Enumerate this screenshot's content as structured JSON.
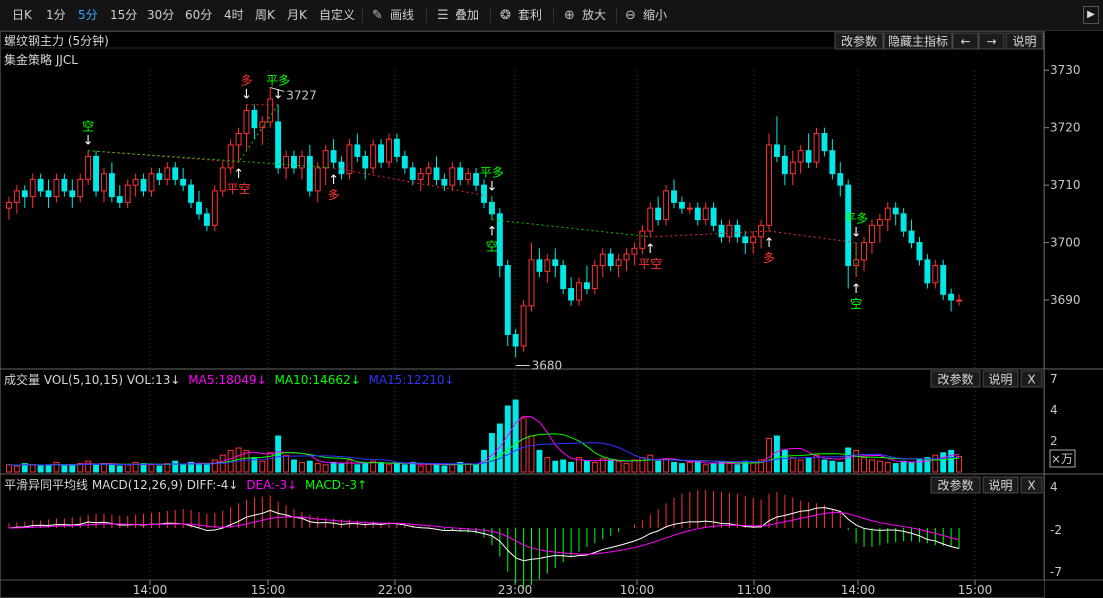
{
  "toolbar": {
    "periods": [
      "日K",
      "1分",
      "5分",
      "15分",
      "30分",
      "60分",
      "4时",
      "周K",
      "月K",
      "自定义"
    ],
    "active_period": "5分",
    "tools": [
      {
        "icon": "pencil-icon",
        "label": "画线"
      },
      {
        "icon": "layers-icon",
        "label": "叠加"
      },
      {
        "icon": "money-bag-icon",
        "label": "套利"
      },
      {
        "icon": "zoom-in-icon",
        "label": "放大"
      },
      {
        "icon": "zoom-out-icon",
        "label": "缩小"
      }
    ],
    "next_glyph": "▶"
  },
  "main_panel": {
    "title": "螺纹钢主力 (5分钟)",
    "strategy": "集金策略 JJCL",
    "buttons": [
      "改参数",
      "隐藏主指标",
      "←",
      "→",
      "说明"
    ]
  },
  "volume_panel": {
    "label_prefix": "成交量 VOL(5,10,15) VOL:13↓",
    "ma5": "MA5:18049↓",
    "ma10": "MA10:14662↓",
    "ma15": "MA15:12210↓",
    "buttons": [
      "改参数",
      "说明",
      "X"
    ],
    "unit_label": "×万",
    "ticks": [
      "7",
      "4",
      "2"
    ]
  },
  "macd_panel": {
    "label_prefix": "平滑异同平均线 MACD(12,26,9) DIFF:-4↓",
    "dea": "DEA:-3↓",
    "macd": "MACD:-3↑",
    "buttons": [
      "改参数",
      "说明",
      "X"
    ],
    "ticks": [
      "4",
      "-2",
      "-7"
    ]
  },
  "colors": {
    "up": "#ff3232",
    "down": "#00e8e8",
    "ma5": "#ff00ff",
    "ma10": "#00ff00",
    "ma15": "#3333ff",
    "diff": "#ffffff",
    "dea": "#ff00ff",
    "signal_long": "#ff3232",
    "signal_short": "#00ff00",
    "active": "#33aaff"
  },
  "chart_data": {
    "type": "candlestick",
    "price_axis": {
      "ticks": [
        3730,
        3720,
        3710,
        3700,
        3690
      ],
      "range": [
        3678,
        3733
      ]
    },
    "time_axis": [
      "14:00",
      "15:00",
      "22:00",
      "23:00",
      "10:00",
      "11:00",
      "14:00",
      "15:00"
    ],
    "annotations": {
      "high": "3727",
      "low": "3680"
    },
    "signals": [
      {
        "label": "多",
        "kind": "long",
        "bar": 30,
        "at": "top"
      },
      {
        "label": "平多",
        "kind": "close_long",
        "bar": 34,
        "at": "top"
      },
      {
        "label": "平空",
        "kind": "close_short",
        "bar": 29,
        "at": "bottom"
      },
      {
        "label": "空",
        "kind": "short",
        "bar": 10,
        "at": "top"
      },
      {
        "label": "多",
        "kind": "long",
        "bar": 41,
        "at": "bottom"
      },
      {
        "label": "平多",
        "kind": "close_long",
        "bar": 61,
        "at": "top"
      },
      {
        "label": "空",
        "kind": "short",
        "bar": 61,
        "at": "bottom"
      },
      {
        "label": "平空",
        "kind": "close_short",
        "bar": 81,
        "at": "bottom"
      },
      {
        "label": "多",
        "kind": "long",
        "bar": 96,
        "at": "bottom"
      },
      {
        "label": "平多",
        "kind": "close_long",
        "bar": 107,
        "at": "top"
      },
      {
        "label": "空",
        "kind": "short",
        "bar": 107,
        "at": "bottom"
      }
    ],
    "ohlc": [
      [
        3706,
        3708,
        3704,
        3707
      ],
      [
        3707,
        3710,
        3705,
        3709
      ],
      [
        3709,
        3710,
        3706,
        3708
      ],
      [
        3708,
        3712,
        3706,
        3711
      ],
      [
        3711,
        3712,
        3708,
        3709
      ],
      [
        3709,
        3711,
        3706,
        3708
      ],
      [
        3708,
        3712,
        3707,
        3711
      ],
      [
        3711,
        3712,
        3708,
        3709
      ],
      [
        3709,
        3711,
        3706,
        3708
      ],
      [
        3708,
        3712,
        3707,
        3711
      ],
      [
        3711,
        3716,
        3710,
        3715
      ],
      [
        3715,
        3716,
        3708,
        3709
      ],
      [
        3709,
        3713,
        3707,
        3712
      ],
      [
        3712,
        3714,
        3707,
        3708
      ],
      [
        3708,
        3710,
        3706,
        3707
      ],
      [
        3707,
        3711,
        3706,
        3710
      ],
      [
        3710,
        3712,
        3708,
        3711
      ],
      [
        3711,
        3712,
        3708,
        3709
      ],
      [
        3709,
        3713,
        3708,
        3712
      ],
      [
        3712,
        3713,
        3710,
        3711
      ],
      [
        3711,
        3714,
        3710,
        3713
      ],
      [
        3713,
        3714,
        3710,
        3711
      ],
      [
        3711,
        3713,
        3709,
        3710
      ],
      [
        3710,
        3711,
        3706,
        3707
      ],
      [
        3707,
        3709,
        3704,
        3705
      ],
      [
        3705,
        3706,
        3702,
        3703
      ],
      [
        3703,
        3710,
        3702,
        3709
      ],
      [
        3709,
        3714,
        3708,
        3713
      ],
      [
        3713,
        3718,
        3712,
        3717
      ],
      [
        3717,
        3720,
        3714,
        3719
      ],
      [
        3719,
        3724,
        3716,
        3723
      ],
      [
        3723,
        3724,
        3718,
        3720
      ],
      [
        3720,
        3722,
        3717,
        3721
      ],
      [
        3721,
        3727,
        3720,
        3725
      ],
      [
        3721,
        3724,
        3712,
        3713
      ],
      [
        3713,
        3716,
        3711,
        3715
      ],
      [
        3715,
        3716,
        3712,
        3713
      ],
      [
        3713,
        3716,
        3711,
        3715
      ],
      [
        3715,
        3717,
        3708,
        3709
      ],
      [
        3709,
        3714,
        3707,
        3713
      ],
      [
        3713,
        3717,
        3710,
        3716
      ],
      [
        3716,
        3718,
        3713,
        3714
      ],
      [
        3714,
        3715,
        3711,
        3712
      ],
      [
        3712,
        3718,
        3711,
        3717
      ],
      [
        3717,
        3719,
        3714,
        3715
      ],
      [
        3715,
        3716,
        3711,
        3713
      ],
      [
        3713,
        3718,
        3712,
        3717
      ],
      [
        3717,
        3718,
        3713,
        3714
      ],
      [
        3714,
        3719,
        3713,
        3718
      ],
      [
        3718,
        3719,
        3714,
        3715
      ],
      [
        3715,
        3716,
        3712,
        3713
      ],
      [
        3713,
        3714,
        3710,
        3711
      ],
      [
        3711,
        3713,
        3709,
        3712
      ],
      [
        3712,
        3714,
        3710,
        3713
      ],
      [
        3713,
        3715,
        3710,
        3711
      ],
      [
        3711,
        3712,
        3709,
        3710
      ],
      [
        3710,
        3714,
        3709,
        3713
      ],
      [
        3713,
        3714,
        3710,
        3711
      ],
      [
        3711,
        3713,
        3710,
        3712
      ],
      [
        3712,
        3713,
        3709,
        3710
      ],
      [
        3710,
        3711,
        3706,
        3707
      ],
      [
        3707,
        3708,
        3704,
        3705
      ],
      [
        3705,
        3706,
        3694,
        3696
      ],
      [
        3696,
        3697,
        3682,
        3684
      ],
      [
        3684,
        3685,
        3680,
        3682
      ],
      [
        3682,
        3690,
        3681,
        3689
      ],
      [
        3689,
        3700,
        3688,
        3697
      ],
      [
        3697,
        3699,
        3694,
        3695
      ],
      [
        3695,
        3698,
        3693,
        3697
      ],
      [
        3697,
        3699,
        3694,
        3696
      ],
      [
        3696,
        3697,
        3691,
        3692
      ],
      [
        3692,
        3694,
        3689,
        3690
      ],
      [
        3690,
        3694,
        3689,
        3693
      ],
      [
        3693,
        3696,
        3691,
        3692
      ],
      [
        3692,
        3697,
        3691,
        3696
      ],
      [
        3696,
        3699,
        3694,
        3698
      ],
      [
        3698,
        3699,
        3695,
        3696
      ],
      [
        3696,
        3698,
        3694,
        3697
      ],
      [
        3697,
        3699,
        3695,
        3698
      ],
      [
        3698,
        3700,
        3696,
        3699
      ],
      [
        3699,
        3703,
        3698,
        3702
      ],
      [
        3702,
        3707,
        3701,
        3706
      ],
      [
        3706,
        3708,
        3703,
        3704
      ],
      [
        3704,
        3710,
        3703,
        3709
      ],
      [
        3709,
        3711,
        3706,
        3707
      ],
      [
        3707,
        3708,
        3705,
        3706
      ],
      [
        3706,
        3707,
        3705,
        3706
      ],
      [
        3706,
        3707,
        3703,
        3704
      ],
      [
        3704,
        3707,
        3703,
        3706
      ],
      [
        3706,
        3707,
        3702,
        3703
      ],
      [
        3703,
        3704,
        3700,
        3701
      ],
      [
        3701,
        3704,
        3700,
        3703
      ],
      [
        3703,
        3704,
        3700,
        3701
      ],
      [
        3701,
        3702,
        3698,
        3700
      ],
      [
        3700,
        3702,
        3698,
        3701
      ],
      [
        3701,
        3704,
        3699,
        3703
      ],
      [
        3703,
        3719,
        3702,
        3717
      ],
      [
        3717,
        3722,
        3714,
        3715
      ],
      [
        3715,
        3717,
        3710,
        3712
      ],
      [
        3712,
        3716,
        3710,
        3714
      ],
      [
        3714,
        3717,
        3712,
        3716
      ],
      [
        3716,
        3719,
        3713,
        3714
      ],
      [
        3714,
        3720,
        3713,
        3719
      ],
      [
        3719,
        3720,
        3715,
        3716
      ],
      [
        3716,
        3718,
        3711,
        3712
      ],
      [
        3712,
        3714,
        3708,
        3710
      ],
      [
        3710,
        3711,
        3692,
        3696
      ],
      [
        3696,
        3700,
        3694,
        3697
      ],
      [
        3697,
        3701,
        3695,
        3700
      ],
      [
        3700,
        3704,
        3698,
        3703
      ],
      [
        3703,
        3705,
        3700,
        3704
      ],
      [
        3704,
        3707,
        3702,
        3706
      ],
      [
        3706,
        3707,
        3703,
        3705
      ],
      [
        3705,
        3706,
        3701,
        3702
      ],
      [
        3702,
        3704,
        3699,
        3700
      ],
      [
        3700,
        3701,
        3696,
        3697
      ],
      [
        3697,
        3698,
        3692,
        3693
      ],
      [
        3693,
        3697,
        3692,
        3696
      ],
      [
        3696,
        3697,
        3690,
        3691
      ],
      [
        3691,
        3692,
        3688,
        3690
      ],
      [
        3690,
        3691,
        3689,
        3690
      ]
    ],
    "volume": [
      6,
      5,
      7,
      6,
      5,
      6,
      8,
      5,
      6,
      7,
      9,
      6,
      7,
      6,
      5,
      6,
      8,
      7,
      6,
      5,
      7,
      9,
      6,
      8,
      7,
      6,
      10,
      14,
      18,
      20,
      18,
      12,
      9,
      16,
      30,
      14,
      10,
      8,
      9,
      7,
      6,
      8,
      7,
      10,
      6,
      7,
      9,
      8,
      6,
      7,
      6,
      8,
      5,
      7,
      6,
      5,
      6,
      8,
      7,
      6,
      18,
      32,
      40,
      55,
      60,
      45,
      30,
      18,
      12,
      9,
      10,
      8,
      12,
      9,
      8,
      11,
      10,
      9,
      7,
      10,
      12,
      14,
      9,
      11,
      8,
      7,
      8,
      9,
      6,
      7,
      8,
      7,
      6,
      9,
      8,
      10,
      28,
      30,
      18,
      12,
      10,
      12,
      14,
      10,
      9,
      8,
      20,
      18,
      12,
      10,
      9,
      8,
      7,
      9,
      8,
      10,
      12,
      14,
      16,
      18,
      13
    ],
    "macd": [
      0.5,
      0.6,
      0.7,
      0.8,
      0.8,
      0.9,
      1.0,
      1.0,
      1.1,
      1.2,
      1.4,
      1.5,
      1.5,
      1.4,
      1.3,
      1.3,
      1.4,
      1.5,
      1.6,
      1.7,
      1.8,
      1.9,
      2.0,
      1.9,
      1.7,
      1.5,
      1.6,
      1.8,
      2.2,
      2.6,
      3.0,
      3.2,
      3.3,
      3.4,
      2.8,
      2.4,
      2.0,
      1.7,
      1.4,
      1.2,
      1.1,
      1.0,
      0.9,
      0.9,
      0.8,
      0.7,
      0.7,
      0.6,
      0.6,
      0.5,
      0.4,
      0.3,
      0.2,
      0.1,
      0.0,
      -0.2,
      -0.3,
      -0.4,
      -0.5,
      -0.6,
      -1.0,
      -1.8,
      -3.0,
      -4.6,
      -5.8,
      -6.4,
      -6.0,
      -5.4,
      -4.8,
      -4.2,
      -3.6,
      -3.0,
      -2.5,
      -2.0,
      -1.6,
      -1.2,
      -0.8,
      -0.4,
      0.0,
      0.4,
      0.8,
      1.4,
      2.0,
      2.6,
      3.2,
      3.6,
      3.8,
      4.0,
      4.0,
      3.9,
      3.8,
      3.7,
      3.6,
      3.4,
      3.2,
      3.0,
      3.6,
      3.8,
      3.5,
      3.2,
      2.9,
      2.7,
      2.6,
      2.4,
      2.0,
      1.6,
      -0.2,
      -1.6,
      -2.0,
      -2.0,
      -1.8,
      -1.6,
      -1.5,
      -1.4,
      -1.4,
      -1.5,
      -1.6,
      -1.8,
      -1.9,
      -2.0,
      -2.2
    ]
  }
}
